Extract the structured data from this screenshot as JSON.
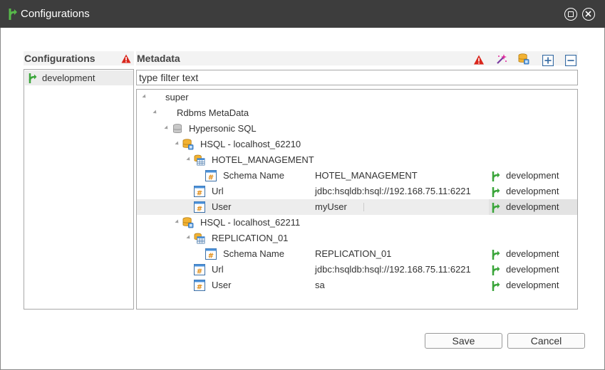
{
  "window": {
    "title": "Configurations"
  },
  "configurations_pane": {
    "header": "Configurations",
    "items": [
      {
        "label": "development",
        "icon": "branch-icon"
      }
    ]
  },
  "metadata_pane": {
    "header": "Metadata",
    "toolbar": [
      "warning-icon",
      "wand-icon",
      "database-add-icon",
      "expand-all-icon",
      "collapse-all-icon"
    ],
    "filter_placeholder": "type filter text",
    "tree": {
      "super": "super",
      "rdbms": "Rdbms MetaData",
      "hypersonic": "Hypersonic SQL",
      "conn1": {
        "label": "HSQL - localhost_62210",
        "schema": "HOTEL_MANAGEMENT",
        "props": [
          {
            "name": "Schema Name",
            "value": "HOTEL_MANAGEMENT",
            "config": "development"
          },
          {
            "name": "Url",
            "value": "jdbc:hsqldb:hsql://192.168.75.11:6221",
            "config": "development"
          },
          {
            "name": "User",
            "value": "myUser",
            "config": "development"
          }
        ]
      },
      "conn2": {
        "label": "HSQL - localhost_62211",
        "schema": "REPLICATION_01",
        "props": [
          {
            "name": "Schema Name",
            "value": "REPLICATION_01",
            "config": "development"
          },
          {
            "name": "Url",
            "value": "jdbc:hsqldb:hsql://192.168.75.11:6221",
            "config": "development"
          },
          {
            "name": "User",
            "value": "sa",
            "config": "development"
          }
        ]
      }
    }
  },
  "buttons": {
    "save": "Save",
    "cancel": "Cancel"
  },
  "colors": {
    "titlebar": "#3d3d3d",
    "branch_green": "#3aa53a",
    "warning_red": "#d9261c"
  }
}
